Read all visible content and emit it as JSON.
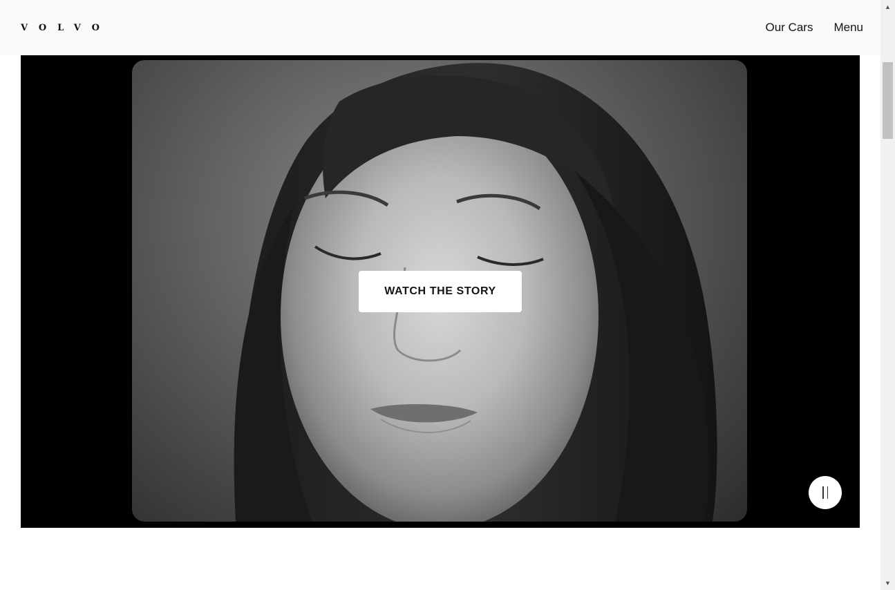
{
  "header": {
    "logo_text": "VOLVO",
    "nav": [
      {
        "label": "Our Cars"
      },
      {
        "label": "Menu"
      }
    ]
  },
  "hero": {
    "media_description_icon": "video-still",
    "cta_label": "WATCH THE STORY",
    "pause_icon": "pause-icon"
  },
  "colors": {
    "header_bg": "#fafafa",
    "hero_bg": "#000000",
    "cta_bg": "#ffffff",
    "text": "#141414"
  },
  "scrollbar": {
    "up_icon": "scroll-up-arrow-icon",
    "down_icon": "scroll-down-arrow-icon"
  }
}
